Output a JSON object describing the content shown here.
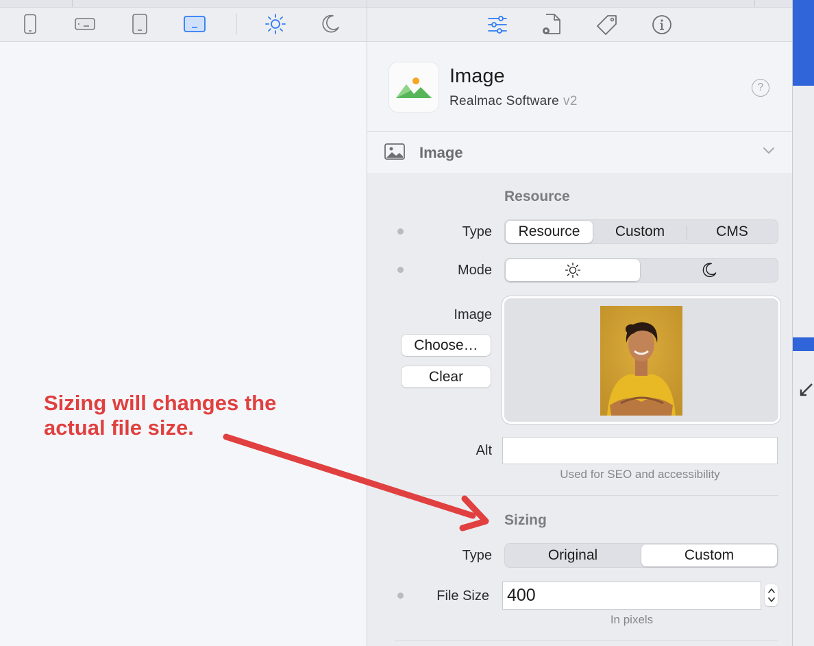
{
  "device_toolbar": {
    "buttons": [
      {
        "icon": "phone-icon"
      },
      {
        "icon": "tablet-landscape-icon"
      },
      {
        "icon": "tablet-portrait-icon"
      },
      {
        "icon": "desktop-icon",
        "selected": true
      },
      {
        "icon": "light-mode-sun-icon",
        "selected": true
      },
      {
        "icon": "dark-mode-moon-icon"
      }
    ]
  },
  "annotation": {
    "line1": "Sizing will changes the",
    "line2": "actual file size.",
    "color": "#e0403f"
  },
  "inspector_tabs": [
    {
      "icon": "sliders-icon",
      "selected": true
    },
    {
      "icon": "page-settings-icon"
    },
    {
      "icon": "tag-icon"
    },
    {
      "icon": "info-icon"
    }
  ],
  "plugin": {
    "title": "Image",
    "vendor": "Realmac Software",
    "version": "v2",
    "help": "?"
  },
  "section": {
    "title": "Image"
  },
  "resource": {
    "group_title": "Resource",
    "type_label": "Type",
    "type_options": [
      "Resource",
      "Custom",
      "CMS"
    ],
    "type_selected": "Resource",
    "mode_label": "Mode",
    "mode_options": [
      {
        "icon": "sun-icon"
      },
      {
        "icon": "moon-icon"
      }
    ],
    "mode_selected": "light",
    "image_label": "Image",
    "choose_button": "Choose…",
    "clear_button": "Clear",
    "alt_label": "Alt",
    "alt_value": "",
    "alt_hint": "Used for SEO and accessibility"
  },
  "sizing": {
    "group_title": "Sizing",
    "type_label": "Type",
    "type_options": [
      "Original",
      "Custom"
    ],
    "type_selected": "Custom",
    "file_size_label": "File Size",
    "file_size_value": "400",
    "file_size_hint": "In pixels"
  },
  "colors": {
    "accent": "#2f7bf5",
    "annotation_red": "#e0403f"
  }
}
